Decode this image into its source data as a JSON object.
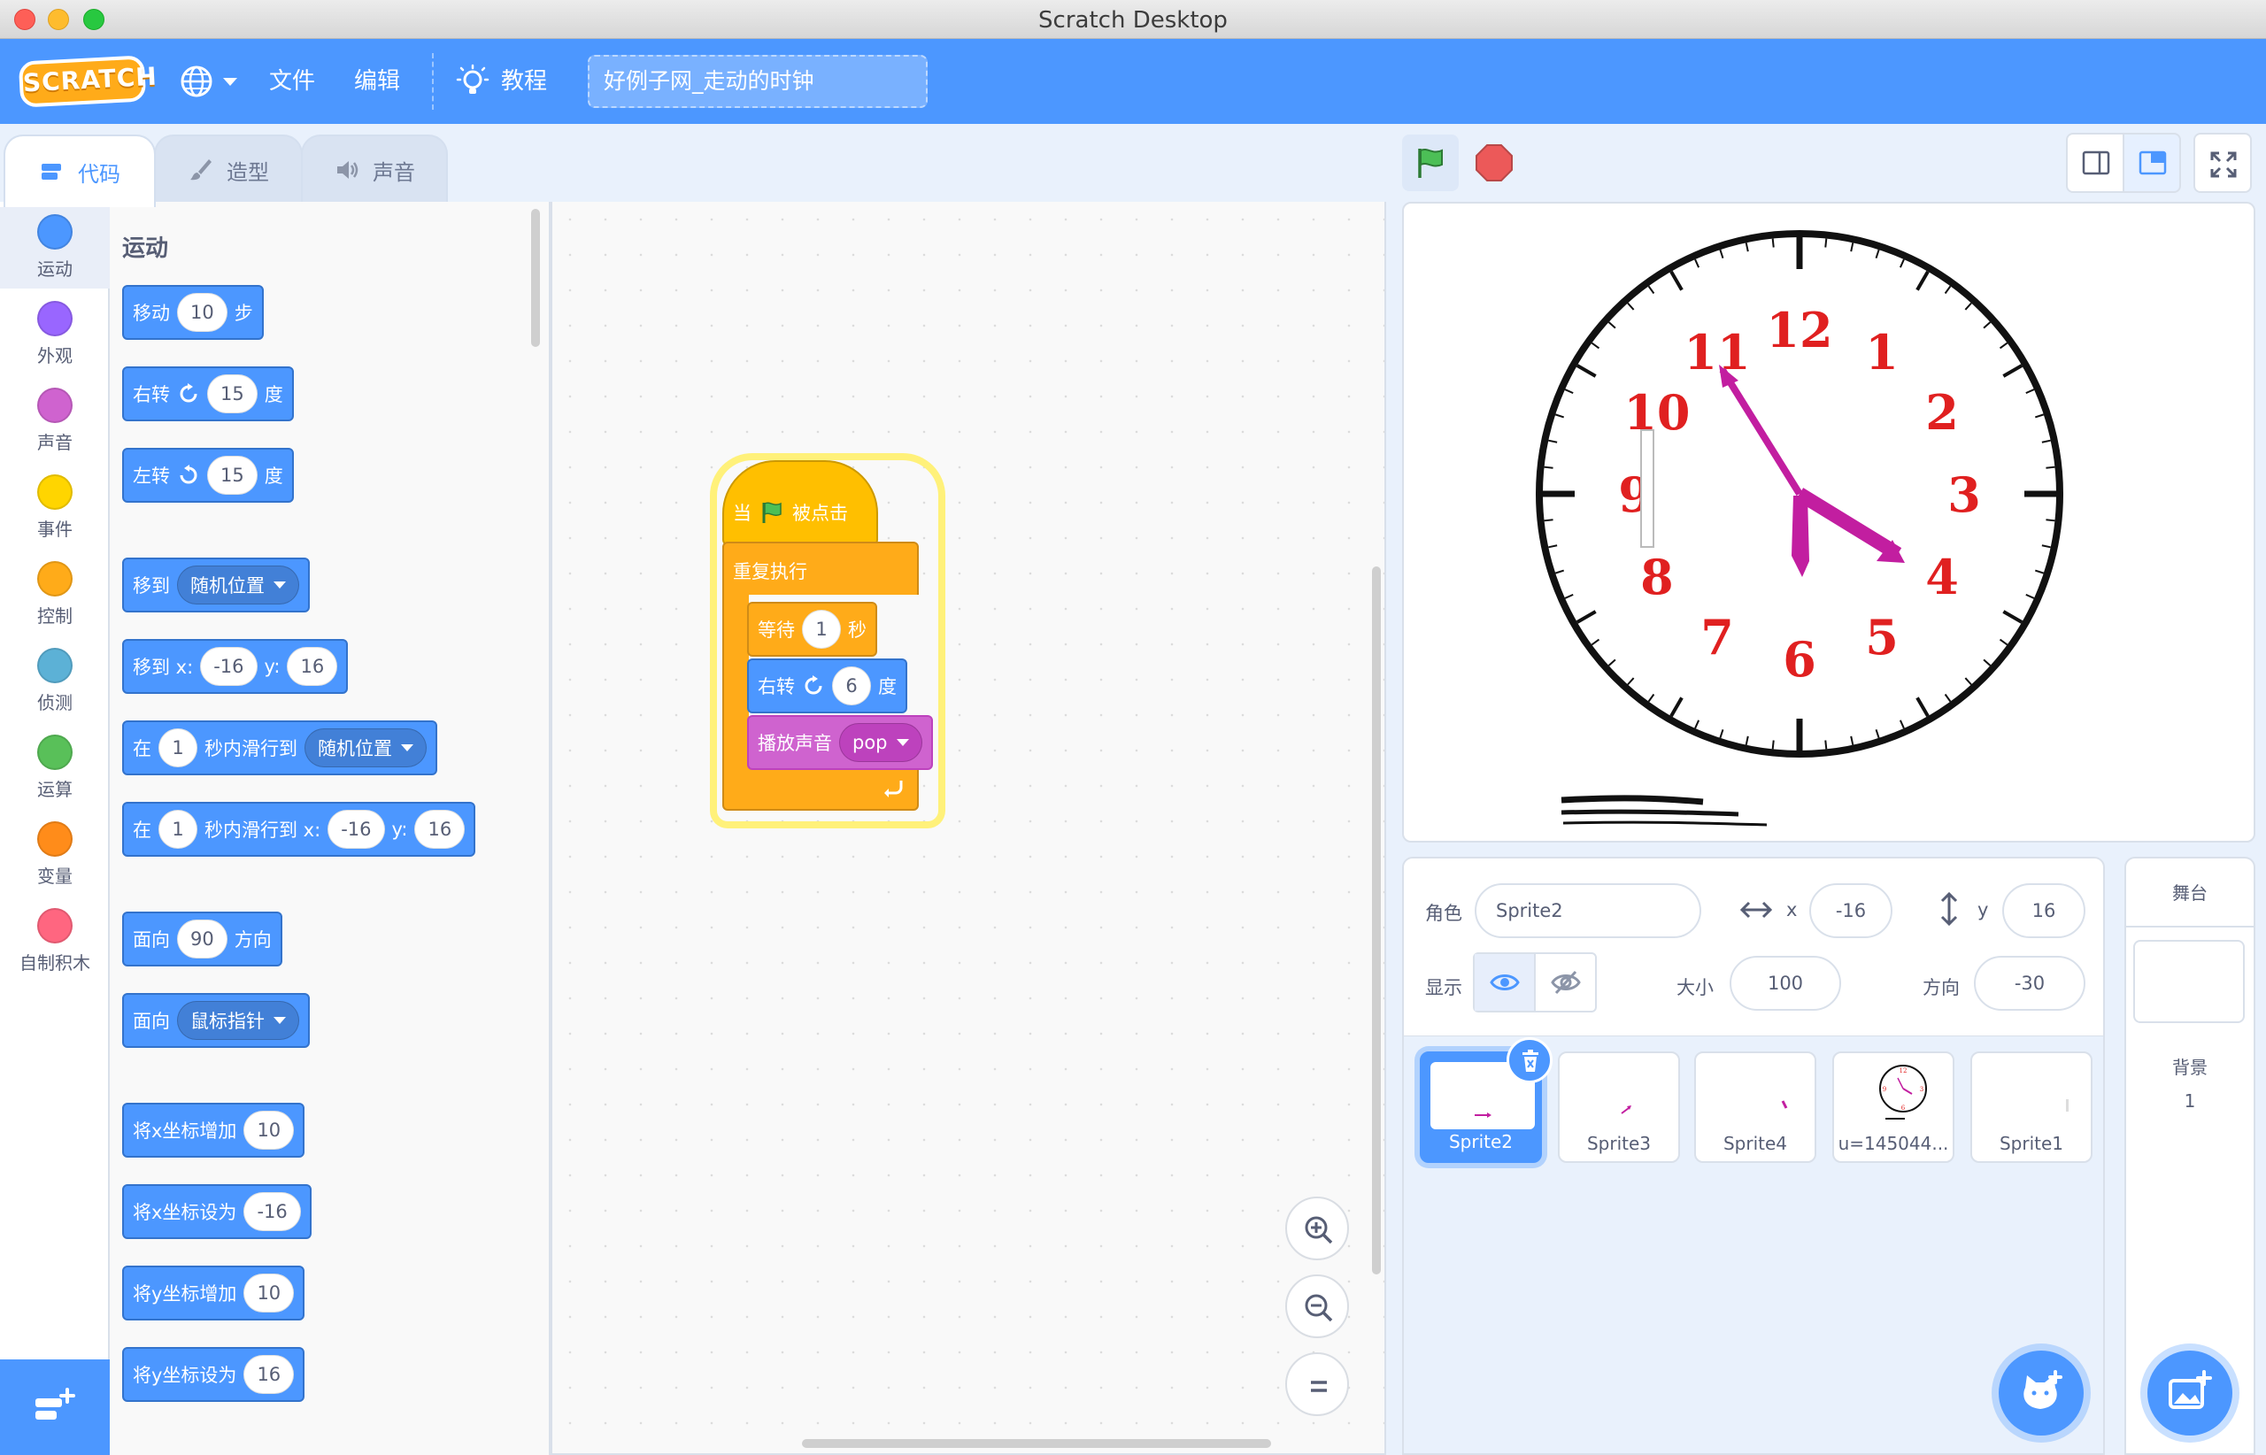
{
  "window": {
    "title": "Scratch Desktop"
  },
  "menubar": {
    "logo": "SCRATCH",
    "file": "文件",
    "edit": "编辑",
    "tutorials": "教程",
    "project_title": "好例子网_走动的时钟"
  },
  "tabs": [
    {
      "label": "代码",
      "active": true
    },
    {
      "label": "造型",
      "active": false
    },
    {
      "label": "声音",
      "active": false
    }
  ],
  "categories": [
    {
      "label": "运动",
      "color": "#4c97ff"
    },
    {
      "label": "外观",
      "color": "#9966ff"
    },
    {
      "label": "声音",
      "color": "#cf63cf"
    },
    {
      "label": "事件",
      "color": "#ffd500"
    },
    {
      "label": "控制",
      "color": "#ffab19"
    },
    {
      "label": "侦测",
      "color": "#5cb1d6"
    },
    {
      "label": "运算",
      "color": "#59c059"
    },
    {
      "label": "变量",
      "color": "#ff8c1a"
    },
    {
      "label": "自制积木",
      "color": "#ff6680"
    }
  ],
  "palette": {
    "section_title": "运动",
    "move": {
      "label": "移动",
      "steps": "10",
      "unit": "步"
    },
    "turn_right": {
      "label": "右转",
      "degrees": "15",
      "unit": "度"
    },
    "turn_left": {
      "label": "左转",
      "degrees": "15",
      "unit": "度"
    },
    "goto": {
      "label": "移到",
      "target": "随机位置"
    },
    "goto_xy": {
      "label": "移到 x:",
      "x": "-16",
      "ylabel": "y:",
      "y": "16"
    },
    "glide": {
      "prefix": "在",
      "secs": "1",
      "mid": "秒内滑行到",
      "target": "随机位置"
    },
    "glide_xy": {
      "prefix": "在",
      "secs": "1",
      "mid": "秒内滑行到 x:",
      "x": "-16",
      "ylabel": "y:",
      "y": "16"
    },
    "point_dir": {
      "label": "面向",
      "value": "90",
      "unit": "方向"
    },
    "point_towards": {
      "label": "面向",
      "target": "鼠标指针"
    },
    "change_x": {
      "label": "将x坐标增加",
      "value": "10"
    },
    "set_x": {
      "label": "将x坐标设为",
      "value": "-16"
    },
    "change_y": {
      "label": "将y坐标增加",
      "value": "10"
    },
    "set_y": {
      "label": "将y坐标设为",
      "value": "16"
    }
  },
  "script": {
    "hat_prefix": "当",
    "hat_suffix": "被点击",
    "forever": "重复执行",
    "wait": {
      "label": "等待",
      "value": "1",
      "unit": "秒"
    },
    "turn": {
      "label": "右转",
      "value": "6",
      "unit": "度"
    },
    "play_sound": {
      "label": "播放声音",
      "sound": "pop"
    }
  },
  "clock": {
    "numbers": [
      "12",
      "1",
      "2",
      "3",
      "4",
      "5",
      "6",
      "7",
      "8",
      "9",
      "10",
      "11"
    ]
  },
  "sprite_info": {
    "sprite_label": "角色",
    "sprite_name": "Sprite2",
    "x_label": "x",
    "x": "-16",
    "y_label": "y",
    "y": "16",
    "show_label": "显示",
    "size_label": "大小",
    "size": "100",
    "direction_label": "方向",
    "direction": "-30"
  },
  "sprites": [
    {
      "name": "Sprite2",
      "selected": true
    },
    {
      "name": "Sprite3",
      "selected": false
    },
    {
      "name": "Sprite4",
      "selected": false
    },
    {
      "name": "u=145044...",
      "selected": false
    },
    {
      "name": "Sprite1",
      "selected": false
    }
  ],
  "stage_pane": {
    "title": "舞台",
    "backdrops_label": "背景",
    "backdrop_count": "1"
  },
  "colors": {
    "accent": "#4c97ff",
    "clock_numbers": "#e02020",
    "clock_hands": "#c21ea0"
  }
}
